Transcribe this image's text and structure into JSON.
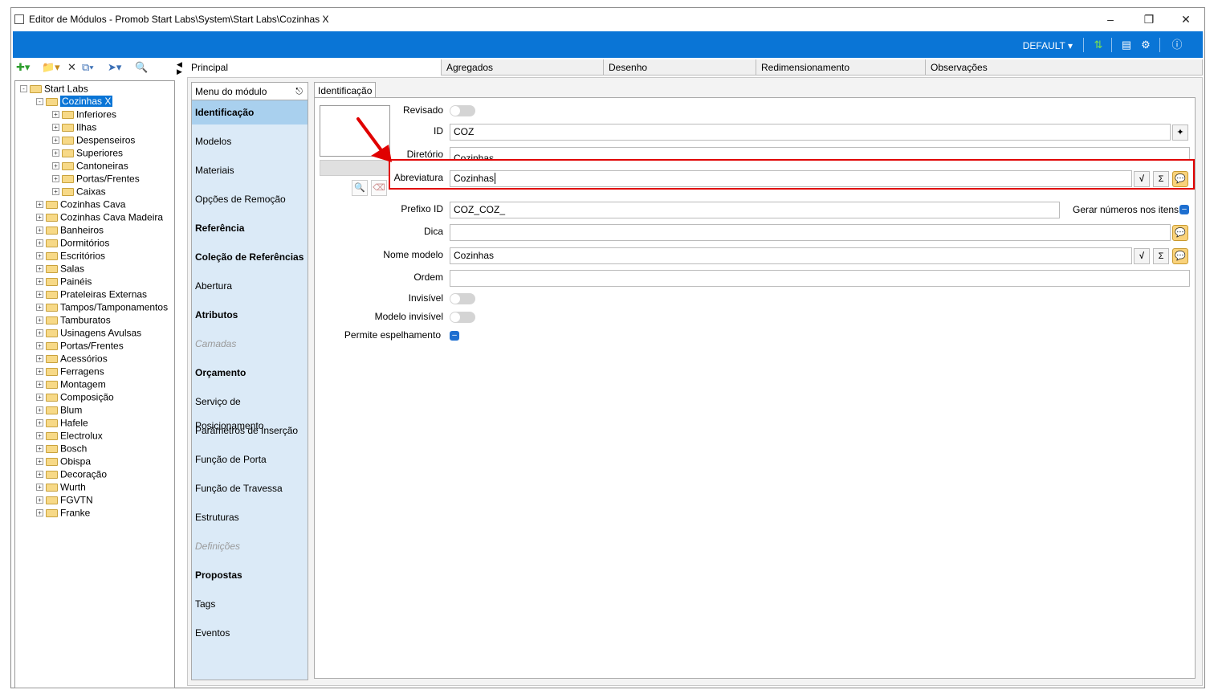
{
  "window": {
    "title": "Editor de Módulos - Promob Start Labs\\System\\Start Labs\\Cozinhas X"
  },
  "topbar": {
    "profile": "DEFAULT"
  },
  "tree": {
    "root": "Start Labs",
    "selected": "Cozinhas X",
    "children_selected": [
      "Inferiores",
      "Ilhas",
      "Despenseiros",
      "Superiores",
      "Cantoneiras",
      "Portas/Frentes",
      "Caixas"
    ],
    "siblings": [
      "Cozinhas Cava",
      "Cozinhas Cava Madeira",
      "Banheiros",
      "Dormitórios",
      "Escritórios",
      "Salas",
      "Painéis",
      "Prateleiras Externas",
      "Tampos/Tamponamentos",
      "Tamburatos",
      "Usinagens Avulsas",
      "Portas/Frentes",
      "Acessórios",
      "Ferragens",
      "Montagem",
      "Composição",
      "Blum",
      "Hafele",
      "Electrolux",
      "Bosch",
      "Obispa",
      "Decoração",
      "Wurth",
      "FGVTN",
      "Franke"
    ]
  },
  "tabs": [
    "Principal",
    "Agregados",
    "Desenho",
    "Redimensionamento",
    "Observações"
  ],
  "module_menu": {
    "header": "Menu do módulo",
    "items": [
      "Identificação",
      "Modelos",
      "Materiais",
      "Opções de Remoção",
      "Referência",
      "Coleção de Referências",
      "Abertura",
      "Atributos",
      "Camadas",
      "Orçamento",
      "Serviço de Posicionamento",
      "Parâmetros de Inserção",
      "Função de Porta",
      "Função de Travessa",
      "Estruturas",
      "Definições",
      "Propostas",
      "Tags",
      "Eventos"
    ]
  },
  "form": {
    "subtab": "Identificação",
    "revisado_label": "Revisado",
    "id_label": "ID",
    "id_value": "COZ",
    "diretorio_label": "Diretório",
    "diretorio_value": "Cozinhas",
    "abreviatura_label": "Abreviatura",
    "abreviatura_value": "Cozinhas",
    "prefixo_label": "Prefixo ID",
    "prefixo_value": "COZ_COZ_",
    "gerar_label": "Gerar números nos itens",
    "dica_label": "Dica",
    "dica_value": "",
    "nome_label": "Nome modelo",
    "nome_value": "Cozinhas",
    "ordem_label": "Ordem",
    "ordem_value": "",
    "invisivel_label": "Invisível",
    "modelo_invisivel_label": "Modelo invisível",
    "espelhamento_label": "Permite espelhamento"
  }
}
